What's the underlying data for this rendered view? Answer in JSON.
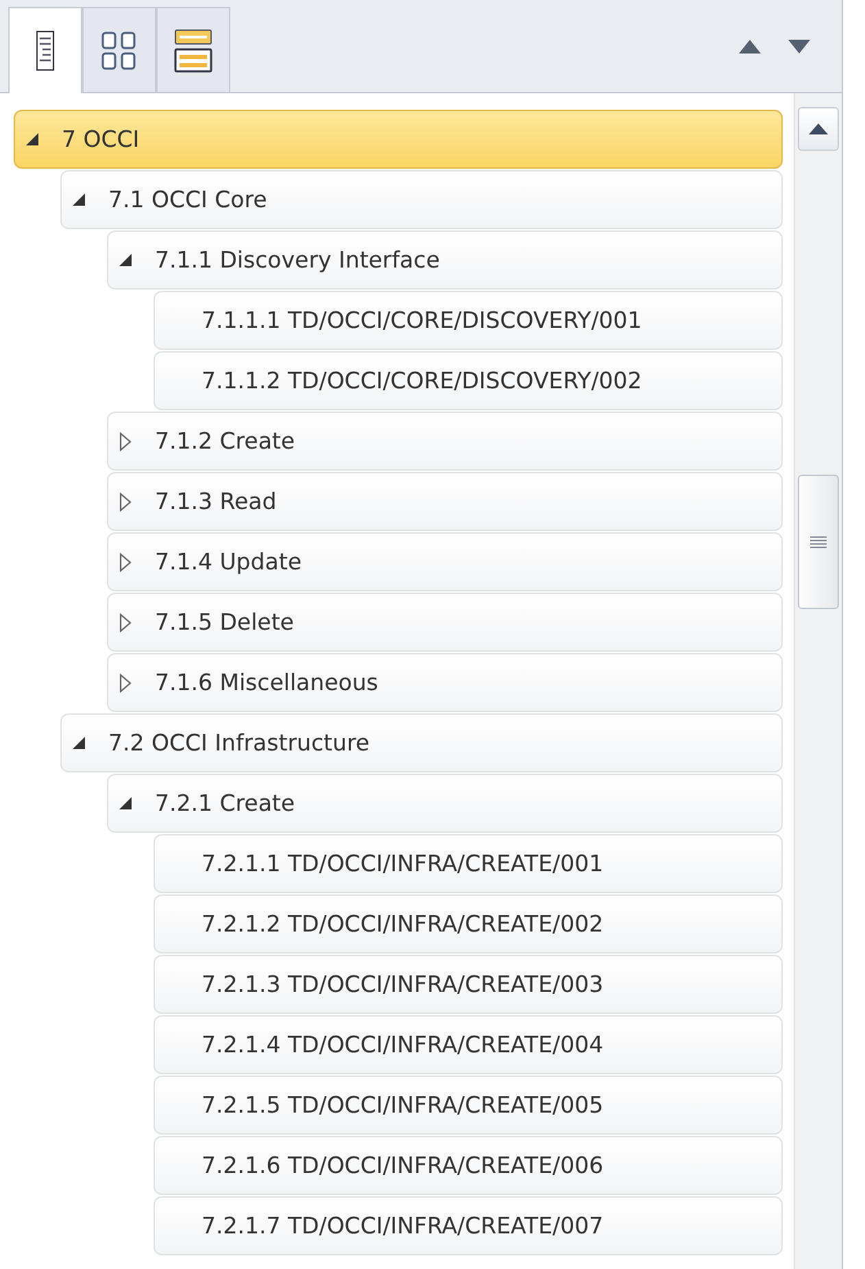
{
  "tabs": [
    {
      "kind": "headings",
      "selected": true
    },
    {
      "kind": "pages",
      "selected": false
    },
    {
      "kind": "results",
      "selected": false
    }
  ],
  "tree": [
    {
      "label": "7 OCCI",
      "expanded": true,
      "selected": true,
      "children": [
        {
          "label": "7.1 OCCI Core",
          "expanded": true,
          "selected": false,
          "children": [
            {
              "label": "7.1.1 Discovery Interface",
              "expanded": true,
              "selected": false,
              "children": [
                {
                  "label": "7.1.1.1 TD/OCCI/CORE/DISCOVERY/001",
                  "selected": false
                },
                {
                  "label": "7.1.1.2 TD/OCCI/CORE/DISCOVERY/002",
                  "selected": false
                }
              ]
            },
            {
              "label": "7.1.2 Create",
              "expanded": false,
              "selected": false
            },
            {
              "label": "7.1.3 Read",
              "expanded": false,
              "selected": false
            },
            {
              "label": "7.1.4 Update",
              "expanded": false,
              "selected": false
            },
            {
              "label": "7.1.5 Delete",
              "expanded": false,
              "selected": false
            },
            {
              "label": "7.1.6 Miscellaneous",
              "expanded": false,
              "selected": false
            }
          ]
        },
        {
          "label": "7.2 OCCI Infrastructure",
          "expanded": true,
          "selected": false,
          "children": [
            {
              "label": "7.2.1 Create",
              "expanded": true,
              "selected": false,
              "children": [
                {
                  "label": "7.2.1.1 TD/OCCI/INFRA/CREATE/001",
                  "selected": false
                },
                {
                  "label": "7.2.1.2 TD/OCCI/INFRA/CREATE/002",
                  "selected": false
                },
                {
                  "label": "7.2.1.3 TD/OCCI/INFRA/CREATE/003",
                  "selected": false
                },
                {
                  "label": "7.2.1.4 TD/OCCI/INFRA/CREATE/004",
                  "selected": false
                },
                {
                  "label": "7.2.1.5 TD/OCCI/INFRA/CREATE/005",
                  "selected": false
                },
                {
                  "label": "7.2.1.6 TD/OCCI/INFRA/CREATE/006",
                  "selected": false
                },
                {
                  "label": "7.2.1.7 TD/OCCI/INFRA/CREATE/007",
                  "selected": false
                }
              ]
            }
          ]
        }
      ]
    }
  ]
}
